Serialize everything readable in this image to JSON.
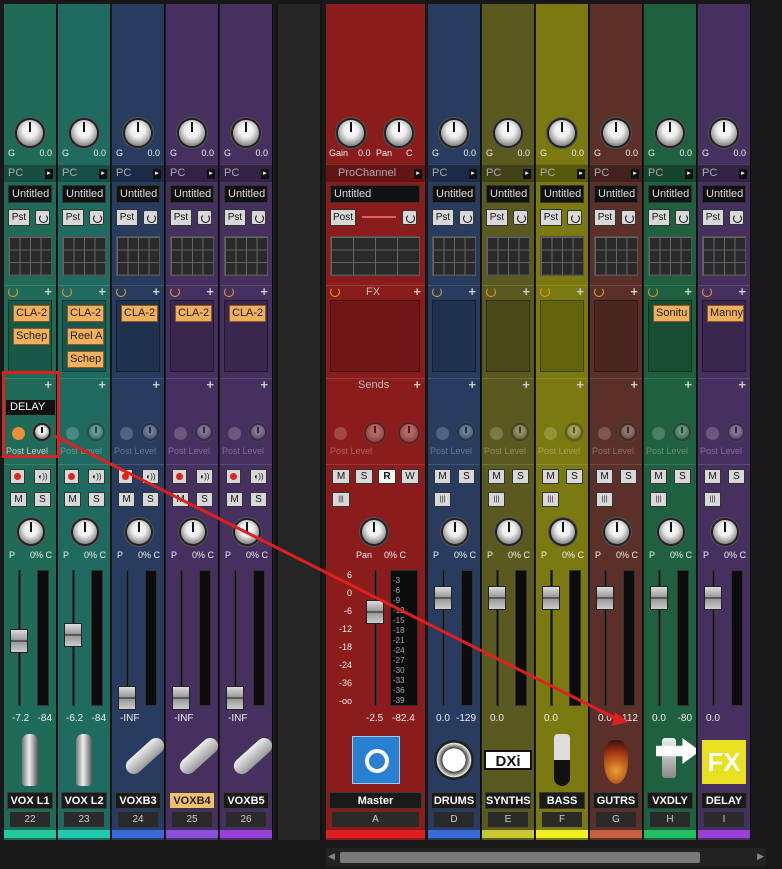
{
  "common": {
    "preset_name": "Untitled",
    "pc_label": "PC",
    "gain_prefix": "G",
    "gain_value": "0.0",
    "pst_label": "Pst",
    "post_level_label": "Post Level",
    "m_label": "M",
    "s_label": "S",
    "pan_prefix": "P",
    "pan_value": "0% C",
    "vol_zero": "0.0"
  },
  "master": {
    "gain_label": "Gain",
    "gain_value": "0.0",
    "pan_label": "Pan",
    "pan_value": "C",
    "prochannel_label": "ProChannel",
    "preset_name": "Untitled",
    "pst_label": "Post",
    "fx_label": "FX",
    "sends_label": "Sends",
    "buttons": [
      "M",
      "S",
      "R",
      "W"
    ],
    "pan_knob_label": "Pan",
    "pan_knob_value": "0% C",
    "fader_scale": [
      "6",
      "0",
      "-6",
      "-12",
      "-18",
      "-24",
      "-36",
      "-oo"
    ],
    "meter_scale": [
      "-3",
      "-6",
      "-9",
      "-12",
      "-15",
      "-18",
      "-21",
      "-24",
      "-27",
      "-30",
      "-33",
      "-36",
      "-39"
    ],
    "vol_value": "-2.5",
    "peak_value": "-82.4",
    "name": "Master",
    "number": "A"
  },
  "tracks": [
    {
      "name": "VOX L1",
      "number": "22",
      "color": "#1f6b57",
      "bar": "#20c9a0",
      "plugins": [
        "CLA-2",
        "Schep"
      ],
      "send_name": "DELAY",
      "vol": "-7.2",
      "peak": "-84"
    },
    {
      "name": "VOX L2",
      "number": "23",
      "color": "#1f6b60",
      "bar": "#20c9b0",
      "plugins": [
        "CLA-2",
        "Reel A",
        "Schep"
      ],
      "send_name": "",
      "vol": "-6.2",
      "peak": "-84"
    },
    {
      "name": "VOXB3",
      "number": "24",
      "color": "#283c60",
      "bar": "#3a6ad8",
      "plugins": [
        "CLA-2"
      ],
      "send_name": "",
      "vol": "-INF",
      "peak": ""
    },
    {
      "name": "VOXB4",
      "number": "25",
      "color": "#463060",
      "bar": "#8a50d8",
      "plugins": [
        "CLA-2"
      ],
      "send_name": "",
      "vol": "-INF",
      "peak": ""
    },
    {
      "name": "VOXB5",
      "number": "26",
      "color": "#463060",
      "bar": "#9a40d8",
      "plugins": [
        "CLA-2"
      ],
      "send_name": "",
      "vol": "-INF",
      "peak": ""
    }
  ],
  "buses": [
    {
      "name": "DRUMS",
      "number": "D",
      "color": "#283c60",
      "bar": "#3a6ad8",
      "plugins": [],
      "vol": "0.0",
      "peak": "-129"
    },
    {
      "name": "SYNTHS",
      "number": "E",
      "color": "#5a5a20",
      "bar": "#c8c830",
      "plugins": [],
      "vol": "0.0",
      "peak": ""
    },
    {
      "name": "BASS",
      "number": "F",
      "color": "#7a7a10",
      "bar": "#f0f020",
      "plugins": [],
      "vol": "0.0",
      "peak": ""
    },
    {
      "name": "GUTRS",
      "number": "G",
      "color": "#5a3028",
      "bar": "#c86040",
      "plugins": [],
      "vol": "0.0",
      "peak": "-112"
    },
    {
      "name": "VXDLY",
      "number": "H",
      "color": "#1f6040",
      "bar": "#20c060",
      "plugins": [
        "Sonitu"
      ],
      "vol": "0.0",
      "peak": "-80"
    },
    {
      "name": "DELAY",
      "number": "I",
      "color": "#463060",
      "bar": "#9a40d8",
      "plugins": [
        "Manny"
      ],
      "vol": "0.0",
      "peak": ""
    }
  ],
  "bus_icons": {
    "synths_badge": "DXi",
    "delay_badge": "FX"
  },
  "colors": {
    "master": "#8a1c1c",
    "highlight": "#e02020"
  }
}
